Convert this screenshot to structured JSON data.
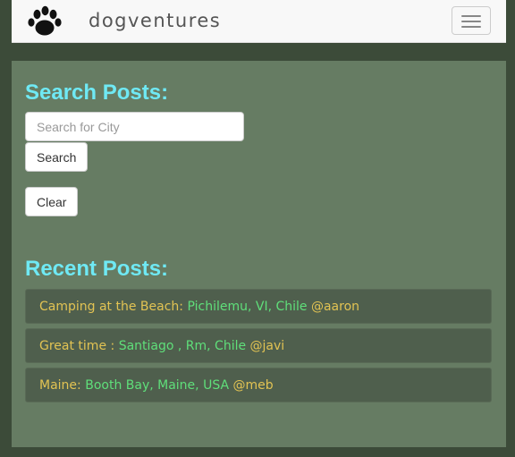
{
  "navbar": {
    "brand": "dogventures",
    "logo_icon": "paw-icon",
    "toggle_icon": "hamburger-icon"
  },
  "search": {
    "heading": "Search Posts:",
    "placeholder": "Search for City",
    "value": "",
    "search_label": "Search",
    "clear_label": "Clear"
  },
  "recent": {
    "heading": "Recent Posts:",
    "posts": [
      {
        "title": "Camping at the Beach:",
        "location": "Pichilemu, VI, Chile",
        "user": "@aaron"
      },
      {
        "title": "Great time :",
        "location": "Santiago , Rm, Chile",
        "user": "@javi"
      },
      {
        "title": "Maine:",
        "location": "Booth Bay, Maine, USA",
        "user": "@meb"
      }
    ]
  },
  "colors": {
    "page_bg": "#3c4b39",
    "panel_bg": "#667c63",
    "heading": "#6fe9f4",
    "post_bg": "#4f5f4d",
    "post_title": "#e2c353",
    "post_location": "#5fdf7a"
  }
}
